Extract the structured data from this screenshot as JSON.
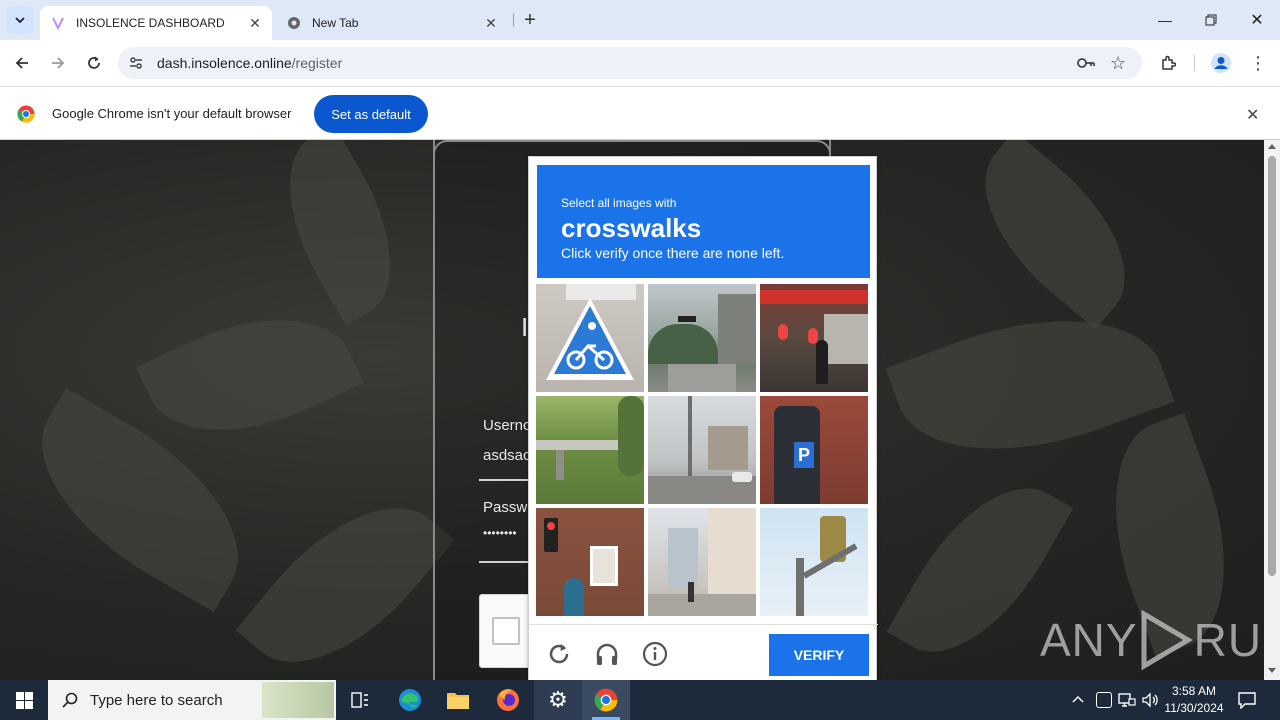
{
  "browser": {
    "tabs": [
      {
        "title": "INSOLENCE DASHBOARD",
        "active": true
      },
      {
        "title": "New Tab",
        "active": false
      }
    ],
    "url_host": "dash.insolence.online",
    "url_path": "/register",
    "infobar": {
      "message": "Google Chrome isn't your default browser",
      "button": "Set as default"
    }
  },
  "login_form": {
    "heading_fragment": "I",
    "username_label": "Usernc",
    "username_value": "asdsac",
    "password_label": "Passw",
    "password_value": "••••••••"
  },
  "captcha": {
    "instruction": "Select all images with",
    "target": "crosswalks",
    "hint": "Click verify once there are none left.",
    "tiles": [
      "bicycle crossing sign",
      "street with traffic light",
      "shopping street with lanterns",
      "bridge over river",
      "intersection with buildings",
      "parking meter",
      "pedestrian traffic light",
      "city street with pedestrians",
      "traffic signal"
    ],
    "verify_label": "VERIFY",
    "accent": "#1a73e8"
  },
  "watermark": {
    "text1": "ANY",
    "text2": "RUN"
  },
  "taskbar": {
    "search_placeholder": "Type here to search",
    "time": "3:58 AM",
    "date": "11/30/2024"
  }
}
